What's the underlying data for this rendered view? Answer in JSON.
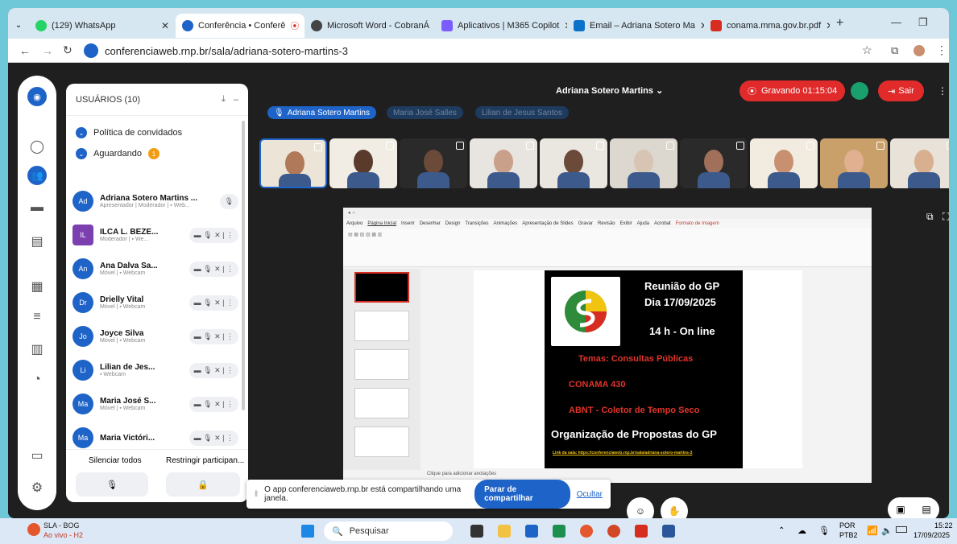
{
  "browser": {
    "tabs": [
      {
        "label": "(129) WhatsApp",
        "color": "#25d366",
        "active": false
      },
      {
        "label": "Conferência • Conferê",
        "color": "#1e63c7",
        "active": true
      },
      {
        "label": "Microsoft Word - CobranÁ",
        "color": "#444",
        "active": false
      },
      {
        "label": "Aplicativos | M365 Copilot",
        "color": "#7a5cff",
        "active": false
      },
      {
        "label": "Email – Adriana Sotero Ma",
        "color": "#0a72c9",
        "active": false
      },
      {
        "label": "conama.mma.gov.br.pdf",
        "color": "#d62d20",
        "active": false
      }
    ],
    "url": "conferenciaweb.rnp.br/sala/adriana-sotero-martins-3"
  },
  "header": {
    "user_name": "Adriana Sotero Martins",
    "recording_label": "Gravando 01:15:04",
    "exit_label": "Sair"
  },
  "speaker_chips": [
    {
      "label": "Adriana Sotero Martins",
      "active": true
    },
    {
      "label": "Maria José Salles",
      "active": false
    },
    {
      "label": "Lilian de Jesus Santos",
      "active": false
    }
  ],
  "panel": {
    "title": "USUÁRIOS (10)",
    "policy_label": "Política de convidados",
    "waiting_label": "Aguardando",
    "waiting_count": "1",
    "mute_all_label": "Silenciar todos",
    "restrict_label": "Restringir participan...",
    "users": [
      {
        "initials": "Ad",
        "name": "Adriana Sotero Martins ...",
        "role": "Apresentador | Moderador | ▪ Web...",
        "color": "#1e63c7"
      },
      {
        "initials": "IL",
        "name": "ILCA L. BEZE...",
        "role": "Moderador | ▪ We...",
        "color": "#7b3fb0"
      },
      {
        "initials": "An",
        "name": "Ana Dalva Sa...",
        "role": "Móvel | ▪ Webcam",
        "color": "#1e63c7"
      },
      {
        "initials": "Dr",
        "name": "Drielly Vital",
        "role": "Móvel | ▪ Webcam",
        "color": "#1e63c7"
      },
      {
        "initials": "Jo",
        "name": "Joyce Silva",
        "role": "Móvel | ▪ Webcam",
        "color": "#1e63c7"
      },
      {
        "initials": "Li",
        "name": "Lilian de Jes...",
        "role": "▪ Webcam",
        "color": "#1e63c7"
      },
      {
        "initials": "Ma",
        "name": "Maria José S...",
        "role": "Móvel | ▪ Webcam",
        "color": "#1e63c7"
      },
      {
        "initials": "Ma",
        "name": "Maria Victóri...",
        "role": "",
        "color": "#1e63c7"
      }
    ]
  },
  "presentation": {
    "menu": [
      "Arquivo",
      "Página Inicial",
      "Inserir",
      "Desenhar",
      "Design",
      "Transições",
      "Animações",
      "Apresentação de Slides",
      "Gravar",
      "Revisão",
      "Exibir",
      "Ajuda",
      "Acrobat",
      "Formato de Imagem"
    ],
    "notes_placeholder": "Clique para adicionar anotações",
    "slide": {
      "line1": "Reunião do GP",
      "line2": "Dia 17/09/2025",
      "line3": "14 h - On line",
      "themes": "Temas: Consultas Públicas",
      "conama": "CONAMA 430",
      "abnt": "ABNT - Coletor de Tempo Seco",
      "org": "Organização de Propostas do GP",
      "link": "Link da sala: https://conferenciaweb.rnp.br/sala/adriana-sotero-martins-3",
      "logo_text": "Grupo de Pesquisa Saúde, Ambiente e Saneamento"
    }
  },
  "share_banner": {
    "text": "O app conferenciaweb.rnp.br está compartilhando uma janela.",
    "stop_label": "Parar de compartilhar",
    "hide_label": "Ocultar"
  },
  "taskbar": {
    "weather_title": "SLA - BOG",
    "weather_sub": "Ao vivo - H2",
    "search_label": "Pesquisar",
    "lang": "POR",
    "layout": "PTB2",
    "time": "15:22",
    "date": "17/09/2025"
  }
}
